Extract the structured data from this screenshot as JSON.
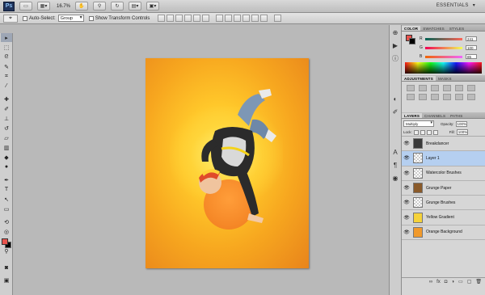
{
  "app": {
    "logo": "Ps",
    "zoom": "16.7%",
    "workspace": "ESSENTIALS"
  },
  "options": {
    "tool_glyph": "⌖",
    "auto_select_label": "Auto-Select:",
    "auto_select_value": "Group",
    "show_transform_label": "Show Transform Controls"
  },
  "color_panel": {
    "tabs": [
      "COLOR",
      "SWATCHES",
      "STYLES"
    ],
    "r_label": "R",
    "r_value": "241",
    "g_label": "G",
    "g_value": "100",
    "b_label": "B",
    "b_value": "85",
    "foreground": "#e8534d",
    "background": "#000000"
  },
  "adjustments_panel": {
    "tabs": [
      "ADJUSTMENTS",
      "MASKS"
    ]
  },
  "layers_panel": {
    "tabs": [
      "LAYERS",
      "CHANNELS",
      "PATHS"
    ],
    "blend_mode": "Multiply",
    "opacity_label": "Opacity:",
    "opacity_value": "100%",
    "lock_label": "Lock:",
    "fill_label": "Fill:",
    "fill_value": "100%",
    "layers": [
      {
        "name": "Breakdancer",
        "thumb": "#3a3a3a",
        "selected": false
      },
      {
        "name": "Layer 1",
        "thumb": "trans",
        "selected": true
      },
      {
        "name": "Watercolor Brushes",
        "thumb": "trans",
        "selected": false
      },
      {
        "name": "Grunge Paper",
        "thumb": "#8a5a2a",
        "selected": false
      },
      {
        "name": "Grunge Brushes",
        "thumb": "trans",
        "selected": false
      },
      {
        "name": "Yellow Gradient",
        "thumb": "#f5d23a",
        "selected": false
      },
      {
        "name": "Orange Background",
        "thumb": "#f19a2c",
        "selected": false
      }
    ]
  }
}
